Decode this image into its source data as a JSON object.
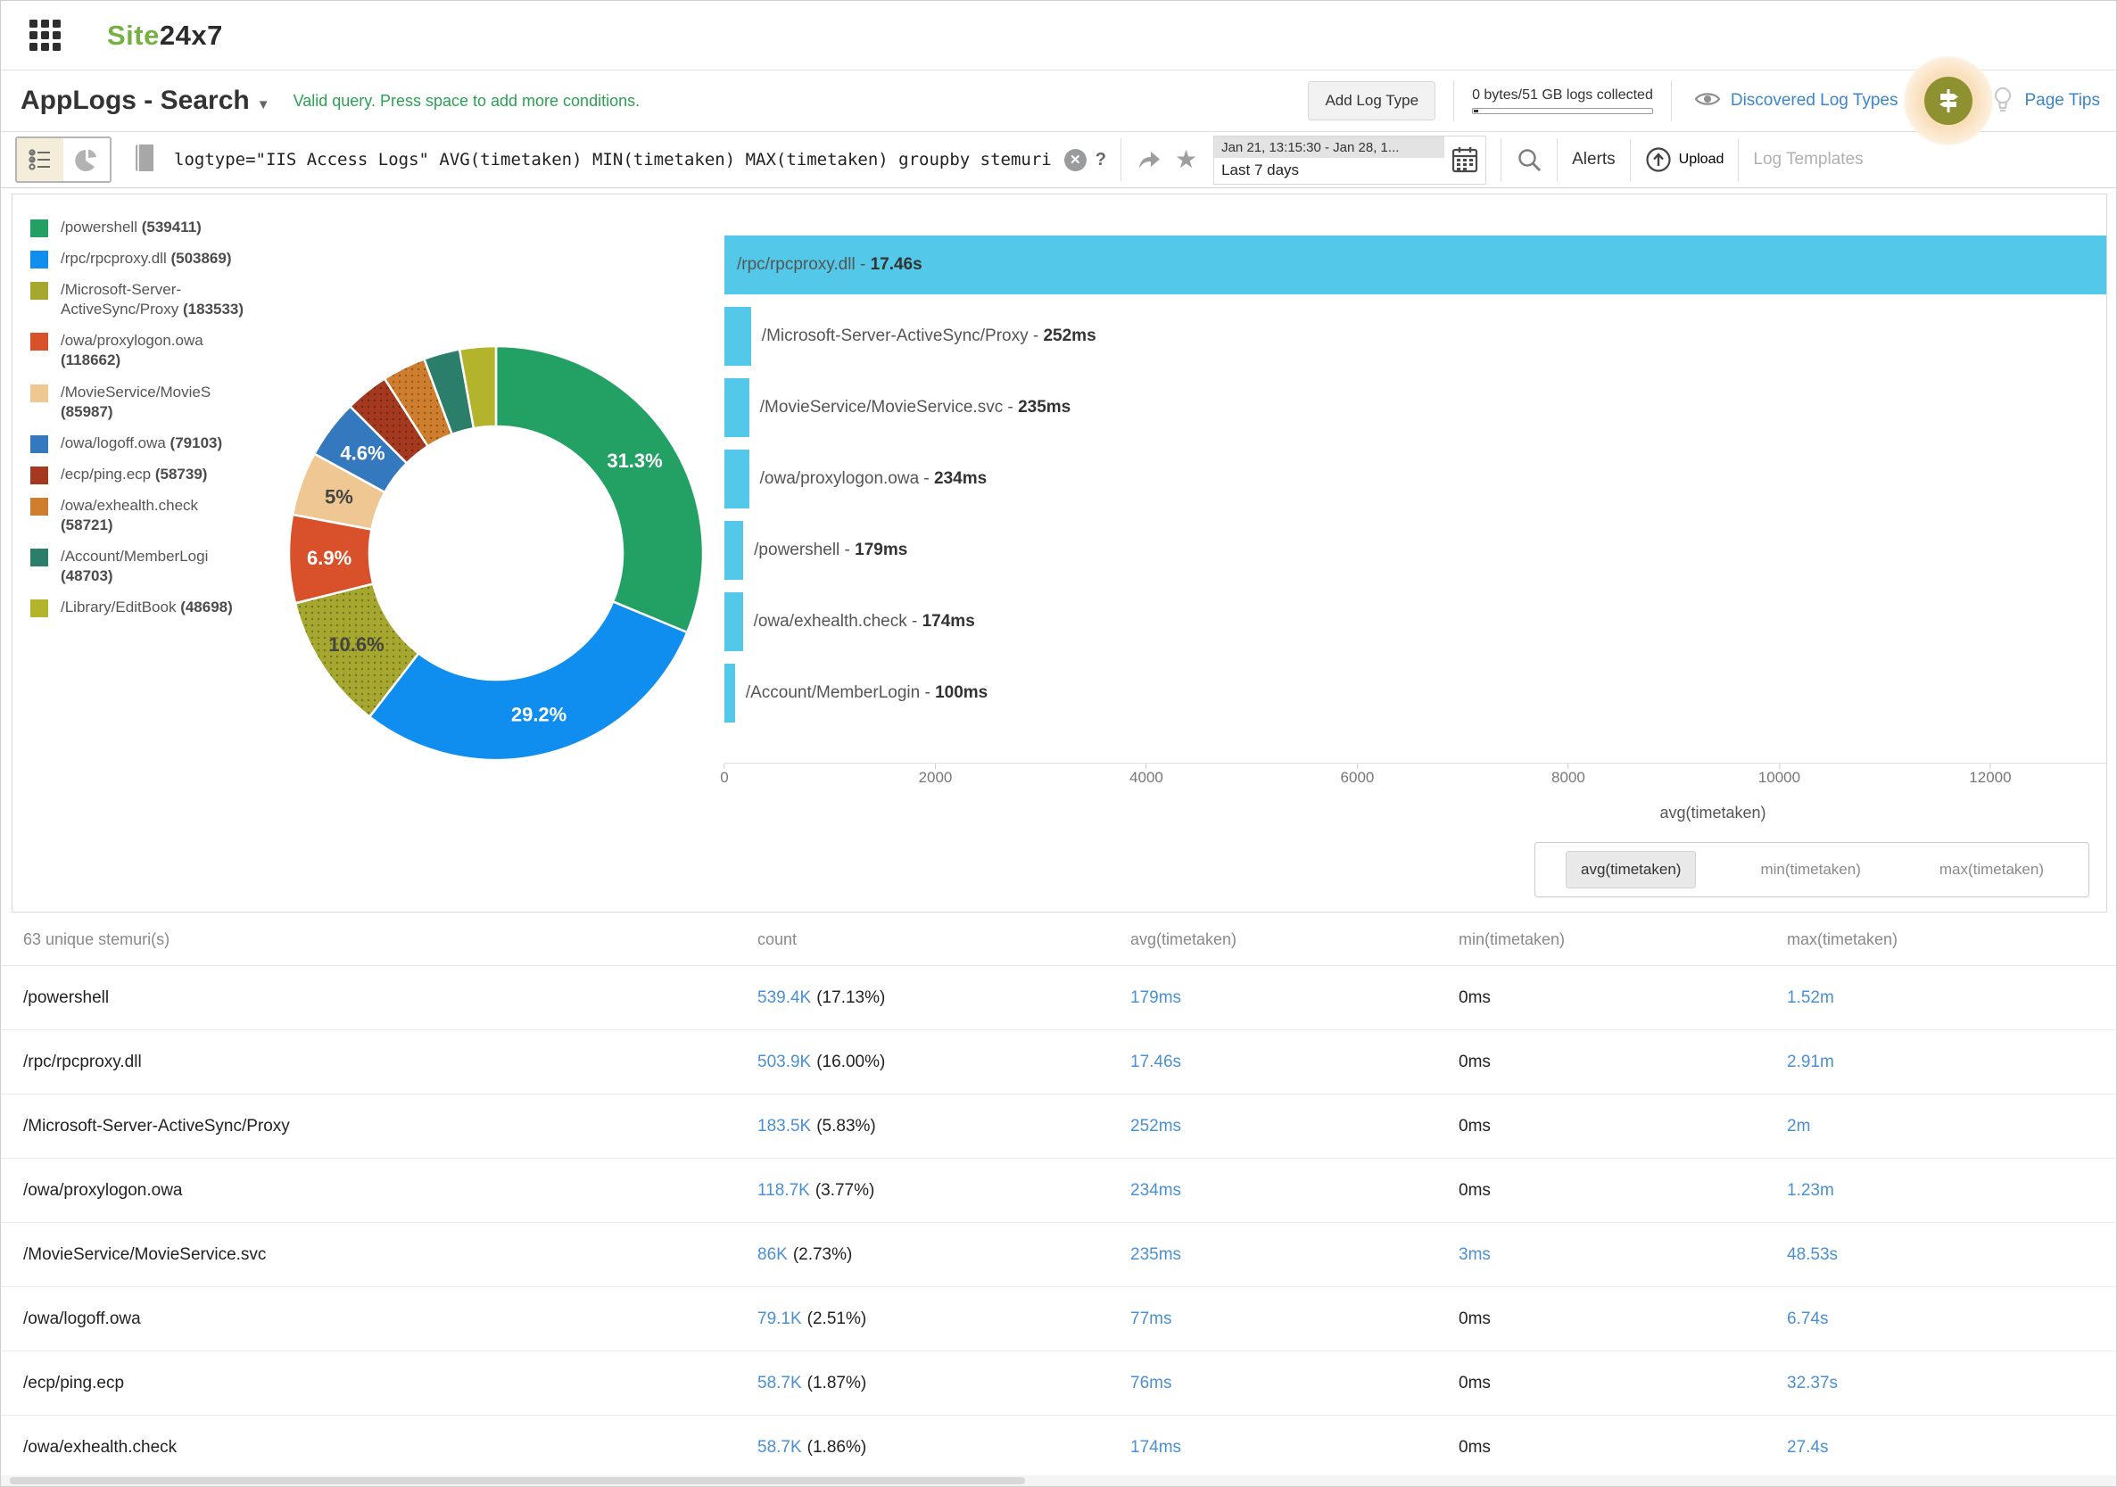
{
  "topbar": {
    "logo_green": "Site",
    "logo_dark": "24x7"
  },
  "header": {
    "title": "AppLogs - Search",
    "status": "Valid query. Press space to add more conditions.",
    "add_log_type": "Add Log Type",
    "quota": "0 bytes/51 GB logs collected",
    "discovered_log_types": "Discovered Log Types",
    "page_tips": "Page Tips"
  },
  "querybar": {
    "query": "logtype=\"IIS Access Logs\" AVG(timetaken) MIN(timetaken) MAX(timetaken) groupby stemuri",
    "help": "?",
    "date_range": "Jan 21, 13:15:30 - Jan 28, 1...",
    "date_label": "Last 7 days",
    "alerts": "Alerts",
    "upload": "Upload",
    "log_templates": "Log Templates"
  },
  "colors": {
    "brand_green": "#76b043",
    "status_green": "#2aa152",
    "link_blue": "#3d85c8",
    "table_link_blue": "#4a90d2",
    "bar_cyan": "#53c8e9"
  },
  "chart_data": [
    {
      "type": "pie",
      "subtype": "donut",
      "legend_position": "left",
      "labels": [
        "/powershell",
        "/rpc/rpcproxy.dll",
        "/Microsoft-Server-ActiveSync/Proxy",
        "/owa/proxylogon.owa",
        "/MovieService/MovieService.svc",
        "/owa/logoff.owa",
        "/ecp/ping.ecp",
        "/owa/exhealth.check",
        "/Account/MemberLogin",
        "/Library/EditBook"
      ],
      "legend_display": [
        "/powershell",
        "/rpc/rpcproxy.dll",
        "/Microsoft-Server-ActiveSync/Proxy",
        "/owa/proxylogon.owa",
        "/MovieService/MovieS",
        "/owa/logoff.owa",
        "/ecp/ping.ecp",
        "/owa/exhealth.check",
        "/Account/MemberLogi",
        "/Library/EditBook"
      ],
      "counts": [
        539411,
        503869,
        183533,
        118662,
        85987,
        79103,
        58739,
        58721,
        48703,
        48698
      ],
      "percent_labels": [
        "31.3%",
        "29.2%",
        "10.6%",
        "6.9%",
        "5%",
        "4.6%",
        "",
        "",
        "",
        ""
      ],
      "colors": [
        "#23a164",
        "#0f8ef0",
        "#a6a72f",
        "#d8512b",
        "#eec793",
        "#3478bd",
        "#a4391f",
        "#cf7e2e",
        "#2b7e69",
        "#b3b42c"
      ],
      "patterned": [
        false,
        false,
        true,
        false,
        false,
        false,
        true,
        true,
        false,
        false
      ]
    },
    {
      "type": "bar",
      "orientation": "horizontal",
      "categories": [
        "/rpc/rpcproxy.dll",
        "/Microsoft-Server-ActiveSync/Proxy",
        "/MovieService/MovieService.svc",
        "/owa/proxylogon.owa",
        "/powershell",
        "/owa/exhealth.check",
        "/Account/MemberLogin"
      ],
      "values": [
        17460,
        252,
        235,
        234,
        179,
        174,
        100
      ],
      "value_labels": [
        "17.46s",
        "252ms",
        "235ms",
        "234ms",
        "179ms",
        "174ms",
        "100ms"
      ],
      "xlabel": "avg(timetaken)",
      "xticks": [
        0,
        2000,
        4000,
        6000,
        8000,
        10000,
        12000
      ],
      "xlim": [
        0,
        13100
      ],
      "grid": false,
      "bar_color": "#53c8e9"
    }
  ],
  "metric_toggle": {
    "options": [
      "avg(timetaken)",
      "min(timetaken)",
      "max(timetaken)"
    ],
    "selected": "avg(timetaken)"
  },
  "table": {
    "title": "63 unique stemuri(s)",
    "columns": [
      "count",
      "avg(timetaken)",
      "min(timetaken)",
      "max(timetaken)"
    ],
    "rows": [
      {
        "name": "/powershell",
        "count": "539.4K",
        "pct": "(17.13%)",
        "avg": "179ms",
        "min": "0ms",
        "max": "1.52m"
      },
      {
        "name": "/rpc/rpcproxy.dll",
        "count": "503.9K",
        "pct": "(16.00%)",
        "avg": "17.46s",
        "min": "0ms",
        "max": "2.91m"
      },
      {
        "name": "/Microsoft-Server-ActiveSync/Proxy",
        "count": "183.5K",
        "pct": "(5.83%)",
        "avg": "252ms",
        "min": "0ms",
        "max": "2m"
      },
      {
        "name": "/owa/proxylogon.owa",
        "count": "118.7K",
        "pct": "(3.77%)",
        "avg": "234ms",
        "min": "0ms",
        "max": "1.23m"
      },
      {
        "name": "/MovieService/MovieService.svc",
        "count": "86K",
        "pct": "(2.73%)",
        "avg": "235ms",
        "min": "3ms",
        "max": "48.53s"
      },
      {
        "name": "/owa/logoff.owa",
        "count": "79.1K",
        "pct": "(2.51%)",
        "avg": "77ms",
        "min": "0ms",
        "max": "6.74s"
      },
      {
        "name": "/ecp/ping.ecp",
        "count": "58.7K",
        "pct": "(1.87%)",
        "avg": "76ms",
        "min": "0ms",
        "max": "32.37s"
      },
      {
        "name": "/owa/exhealth.check",
        "count": "58.7K",
        "pct": "(1.86%)",
        "avg": "174ms",
        "min": "0ms",
        "max": "27.4s"
      }
    ]
  }
}
